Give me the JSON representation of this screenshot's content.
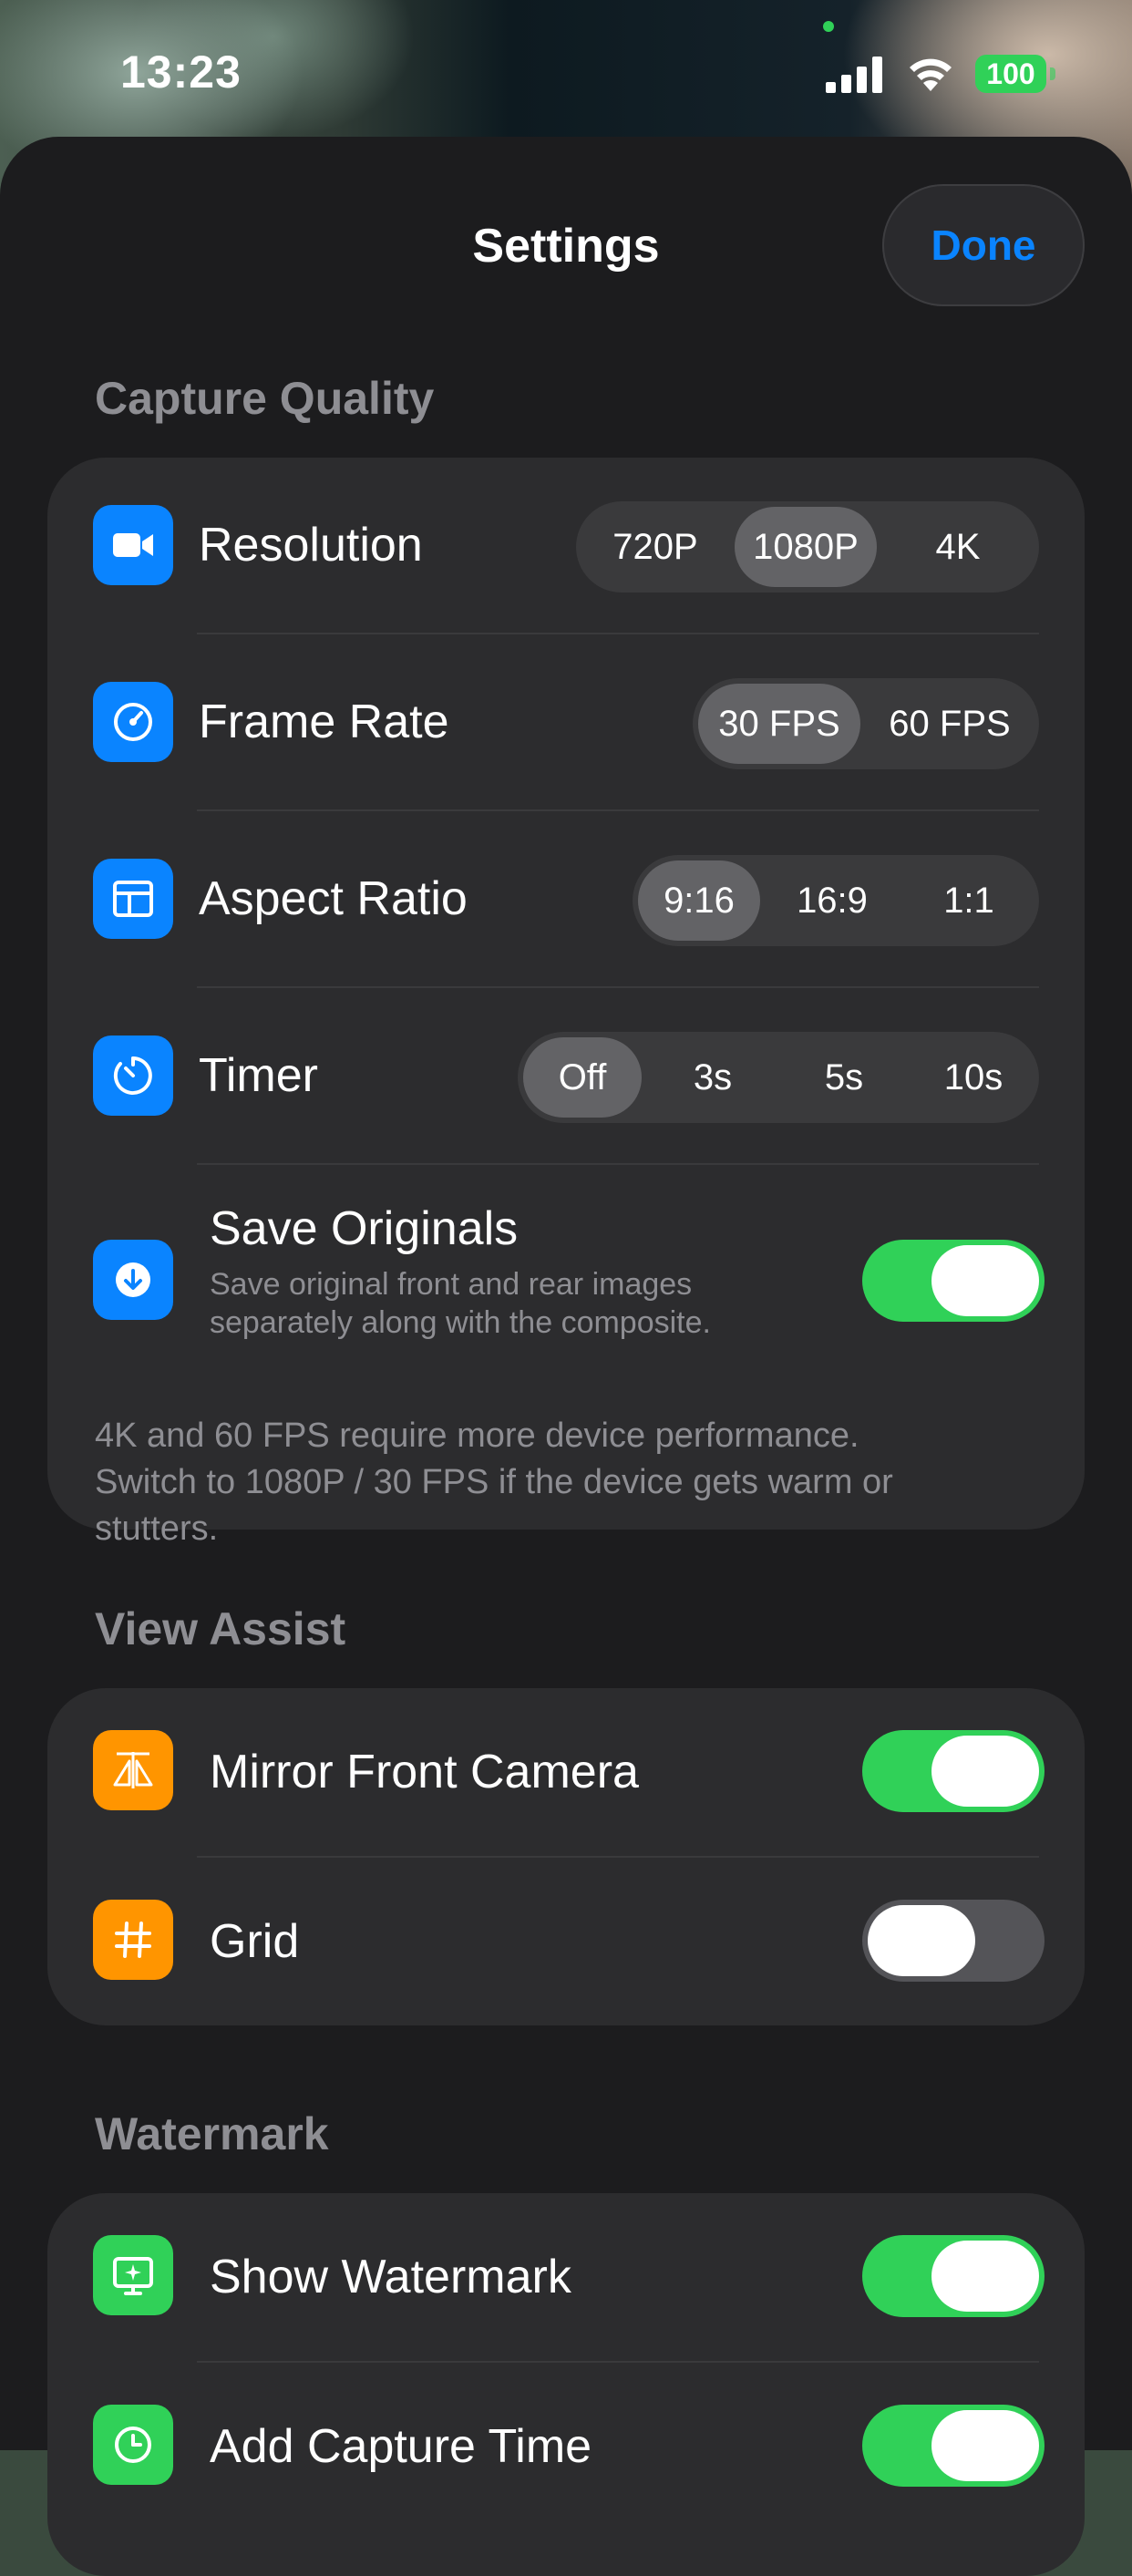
{
  "status_bar": {
    "time": "13:23",
    "battery": "100"
  },
  "sheet": {
    "title": "Settings",
    "done_label": "Done"
  },
  "colors": {
    "accent": "#0a84ff",
    "toggle_on": "#30d158",
    "icon_blue": "#0a84ff",
    "icon_orange": "#ff9500",
    "icon_green": "#30d158"
  },
  "capture_quality": {
    "header": "Capture Quality",
    "resolution": {
      "label": "Resolution",
      "icon": "video-camera-icon",
      "options": [
        "720P",
        "1080P",
        "4K"
      ],
      "selected": "1080P"
    },
    "frame_rate": {
      "label": "Frame Rate",
      "icon": "speedometer-icon",
      "options": [
        "30 FPS",
        "60 FPS"
      ],
      "selected": "30 FPS"
    },
    "aspect_ratio": {
      "label": "Aspect Ratio",
      "icon": "aspect-ratio-icon",
      "options": [
        "9:16",
        "16:9",
        "1:1"
      ],
      "selected": "9:16"
    },
    "timer": {
      "label": "Timer",
      "icon": "timer-icon",
      "options": [
        "Off",
        "3s",
        "5s",
        "10s"
      ],
      "selected": "Off"
    },
    "save_originals": {
      "label": "Save Originals",
      "icon": "download-icon",
      "subtitle_line1": "Save original front and rear images",
      "subtitle_line2": "separately along with the composite.",
      "enabled": true
    },
    "footnote_line1": "4K and 60 FPS require more device performance.",
    "footnote_line2": "Switch to 1080P / 30 FPS if the device gets warm or",
    "footnote_line3": "stutters."
  },
  "view_assist": {
    "header": "View Assist",
    "mirror_front_camera": {
      "label": "Mirror Front Camera",
      "icon": "mirror-icon",
      "enabled": true
    },
    "grid": {
      "label": "Grid",
      "icon": "grid-icon",
      "enabled": false
    }
  },
  "watermark": {
    "header": "Watermark",
    "show_watermark": {
      "label": "Show Watermark",
      "icon": "watermark-icon",
      "enabled": true
    },
    "add_capture_time": {
      "label": "Add Capture Time",
      "icon": "clock-icon",
      "enabled": true
    }
  }
}
